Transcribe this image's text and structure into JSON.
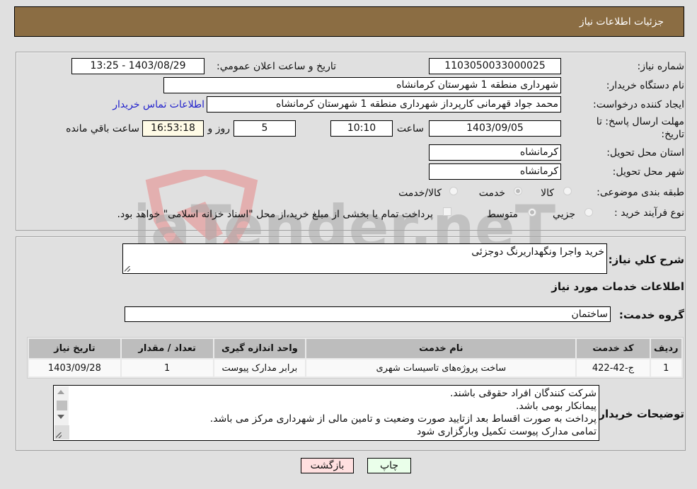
{
  "header": {
    "title": "جزئیات اطلاعات نیاز"
  },
  "need_info": {
    "need_number_label": "شماره نیاز:",
    "need_number": "1103050033000025",
    "announce_label": "تاریخ و ساعت اعلان عمومي:",
    "announce_value": "1403/08/29 - 13:25",
    "buyer_org_label": "نام دستگاه خریدار:",
    "buyer_org": "شهرداری منطقه 1 شهرستان کرمانشاه",
    "creator_label": "ایجاد کننده درخواست:",
    "creator": "محمد جواد قهرمانی کارپرداز شهرداری منطقه 1 شهرستان کرمانشاه",
    "contact_link": "اطلاعات تماس خریدار",
    "deadline_label_line1": "مهلت ارسال پاسخ: تا",
    "deadline_label_line2": "تاریخ:",
    "deadline_date": "1403/09/05",
    "time_label": "ساعت",
    "deadline_time": "10:10",
    "days_value": "5",
    "days_label": "روز و",
    "remaining_time": "16:53:18",
    "remaining_label": "ساعت باقي مانده",
    "province_label": "استان محل تحویل:",
    "province": "کرمانشاه",
    "city_label": "شهر محل تحویل:",
    "city": "کرمانشاه",
    "category_label": "طبقه بندی موضوعی:",
    "category_options": [
      {
        "label": "کالا",
        "checked": false
      },
      {
        "label": "خدمت",
        "checked": true
      },
      {
        "label": "کالا/خدمت",
        "checked": false
      }
    ],
    "process_label": "نوع فرآیند خرید :",
    "process_options": [
      {
        "label": "جزيي",
        "checked": false
      },
      {
        "label": "متوسط",
        "checked": true
      }
    ],
    "treasury_checkbox_label": "پرداخت تمام یا بخشی از مبلغ خرید،از محل \"اسناد خزانه اسلامی\" خواهد بود."
  },
  "details": {
    "description_label": "شرح كلي نياز:",
    "description": "خرید واجرا ونگهداریرنگ دوجزئی",
    "services_heading": "اطلاعات خدمات مورد نياز",
    "service_group_label": "گروه خدمت:",
    "service_group": "ساختمان",
    "table": {
      "headers": [
        "ردیف",
        "کد خدمت",
        "نام خدمت",
        "واحد اندازه گیری",
        "تعداد / مقدار",
        "تاریخ نیاز"
      ],
      "rows": [
        [
          "1",
          "ج-42-422",
          "ساخت پروژه‌های تاسیسات شهری",
          "برابر مدارک پیوست",
          "1",
          "1403/09/28"
        ]
      ]
    },
    "buyer_notes_label": "توضیحات خریدار:",
    "buyer_notes": [
      "شرکت کنندگان افراد حقوقی باشند.",
      "پیمانکار بومی باشد.",
      "پرداخت به صورت اقساط بعد ازتایید صورت وضعیت و تامین مالی از شهرداری مرکز می باشد.",
      "تمامی مدارک پیوست تکمیل وبارگزاری شود"
    ]
  },
  "buttons": {
    "print": "چاپ",
    "back": "بازگشت"
  },
  "watermark": {
    "text": "AriaTender.neT"
  },
  "colors": {
    "header_bg": "#8b6d43",
    "print_bg": "#eaffea",
    "back_bg": "#ffe0e0",
    "link": "#2222cc"
  }
}
